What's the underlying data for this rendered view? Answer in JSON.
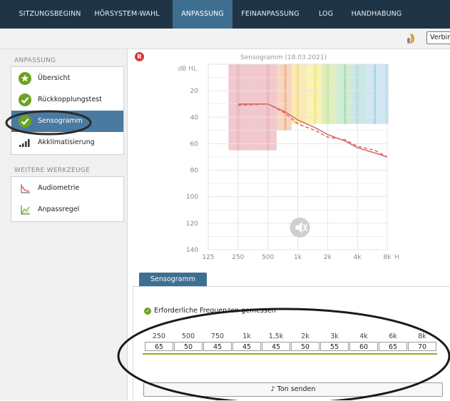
{
  "topnav": {
    "tabs": [
      {
        "label": "SITZUNGSBEGINN",
        "active": false
      },
      {
        "label": "HÖRSYSTEM-WAHL",
        "active": false
      },
      {
        "label": "ANPASSUNG",
        "active": true
      },
      {
        "label": "FEINANPASSUNG",
        "active": false
      },
      {
        "label": "LOG",
        "active": false
      },
      {
        "label": "HANDHABUNG",
        "active": false
      }
    ]
  },
  "toolbar": {
    "icon": "hearing-aid-icon",
    "connect_label": "Verbinden"
  },
  "sidebar": {
    "section1_title": "ANPASSUNG",
    "items": [
      {
        "label": "Übersicht",
        "icon": "star-check-icon",
        "active": false
      },
      {
        "label": "Rückkopplungstest",
        "icon": "check-circle-icon",
        "active": false
      },
      {
        "label": "Sensogramm",
        "icon": "check-circle-icon",
        "active": true
      },
      {
        "label": "Akklimatisierung",
        "icon": "signal-bars-icon",
        "active": false
      }
    ],
    "section2_title": "WEITERE WERKZEUGE",
    "tools": [
      {
        "label": "Audiometrie",
        "icon": "audiometry-icon"
      },
      {
        "label": "Anpassregel",
        "icon": "fitting-rule-icon"
      }
    ]
  },
  "ear_badge": "R",
  "colors": {
    "nav_bg": "#1f3546",
    "nav_active": "#3e6f91",
    "sidebar_active": "#4a7aa0",
    "ok_green": "#6aa323",
    "curve_red": "#d9534f",
    "marker_green": "#86b31c"
  },
  "chart_data": {
    "type": "line",
    "title": "Sensogramm (18.03.2021)",
    "ylabel": "dB HL",
    "xunit": "Hz",
    "x_ticks": [
      "125",
      "250",
      "500",
      "1k",
      "2k",
      "4k",
      "8k"
    ],
    "y_ticks": [
      20,
      40,
      60,
      80,
      100,
      120,
      140
    ],
    "ylim": [
      0,
      140
    ],
    "grid": true,
    "frequencies_hz": [
      250,
      500,
      750,
      1000,
      1500,
      2000,
      3000,
      4000,
      6000,
      8000
    ],
    "series": [
      {
        "style": "solid",
        "values": [
          30,
          30,
          36,
          42,
          48,
          53,
          58,
          63,
          67,
          70
        ]
      },
      {
        "style": "dashed",
        "values": [
          31,
          30,
          37,
          45,
          50,
          55,
          57,
          62,
          65,
          70
        ]
      }
    ],
    "band_lower_db": [
      65,
      65,
      50,
      45,
      45,
      45,
      45,
      45,
      45,
      45
    ],
    "band_colors": [
      "#e59aa5",
      "#e59aa5",
      "#f2b38a",
      "#f6d77a",
      "#f4e97a",
      "#c2e08b",
      "#a7dcb0",
      "#9fd3d2",
      "#a9d2e6",
      "#a9d2e6"
    ],
    "mute_icon": "speaker-muted-icon"
  },
  "panel": {
    "tab_label": "Sensogramm",
    "status_text": "Erforderliche Frequenzen gemessen",
    "freq_labels": [
      "250",
      "500",
      "750",
      "1k",
      "1,5k",
      "2k",
      "3k",
      "4k",
      "6k",
      "8k"
    ],
    "freq_values": [
      "65",
      "50",
      "45",
      "45",
      "45",
      "50",
      "55",
      "60",
      "65",
      "70"
    ],
    "send_button": "Ton senden",
    "send_icon": "music-note-icon"
  }
}
